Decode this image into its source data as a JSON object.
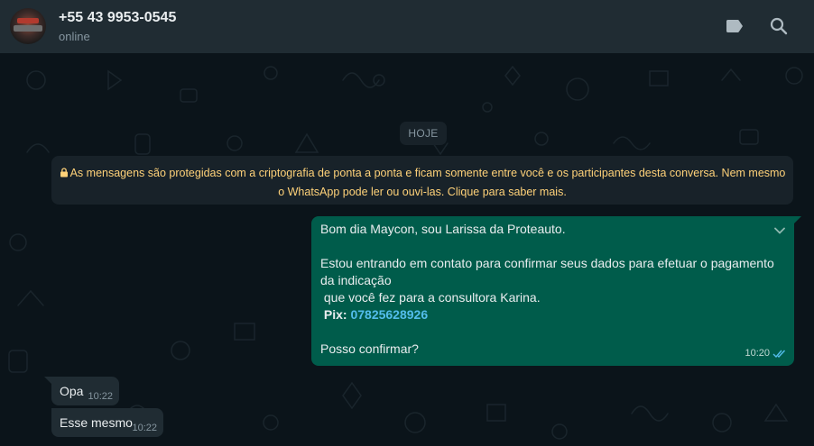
{
  "header": {
    "contact_name": "+55 43 9953-0545",
    "status": "online",
    "icons": [
      "label-icon",
      "search-icon"
    ]
  },
  "chat": {
    "date_chip": "HOJE",
    "encryption_notice": {
      "line1": "As mensagens são protegidas com a criptografia de ponta a ponta e ficam somente entre você e os participantes desta conversa. Nem mesmo",
      "line2": "o WhatsApp pode ler ou ouvi-las. Clique para saber mais."
    },
    "outgoing": {
      "line1": "Bom dia Maycon, sou Larissa da Proteauto.",
      "line2": "Estou entrando em contato para confirmar seus dados para efetuar o pagamento",
      "line3": "da indicação",
      "line4": " que você fez para a consultora Karina.",
      "pix_label": " Pix:",
      "pix_number": "07825628926",
      "line6": "Posso confirmar?",
      "time": "10:20"
    },
    "incoming": [
      {
        "text": "Opa",
        "time": "10:22"
      },
      {
        "text": "Esse mesmo",
        "time": "10:22"
      }
    ]
  },
  "colors": {
    "header_bg": "#202c33",
    "chat_bg": "#0b141a",
    "outgoing_bubble": "#005c4b",
    "incoming_bubble": "#202c33",
    "notice_text": "#ffd279",
    "link": "#53bdeb",
    "read_ticks": "#53bdeb"
  }
}
